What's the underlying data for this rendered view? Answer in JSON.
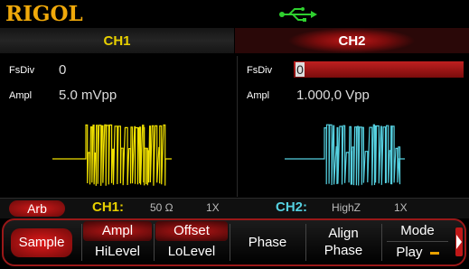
{
  "header": {
    "logo": "RIGOL",
    "usb_icon": "usb-icon"
  },
  "channels": [
    {
      "label": "CH1",
      "color": "#e8d000"
    },
    {
      "label": "CH2",
      "color": "#ffffff",
      "active": true
    }
  ],
  "ch1": {
    "fsdiv_label": "FsDiv",
    "fsdiv_value": "0",
    "ampl_label": "Ampl",
    "ampl_value": "5.0 mVpp",
    "wave_color": "#f0e000"
  },
  "ch2": {
    "fsdiv_label": "FsDiv",
    "fsdiv_value": "0",
    "ampl_label": "Ampl",
    "ampl_value": "1.000,0 Vpp",
    "wave_color": "#55d0e0"
  },
  "status": {
    "mode": "Arb",
    "ch1_label": "CH1:",
    "ch1_impedance": "50 Ω",
    "ch1_mult": "1X",
    "ch2_label": "CH2:",
    "ch2_impedance": "HighZ",
    "ch2_mult": "1X"
  },
  "softkeys": {
    "sample": "Sample",
    "ampl": "Ampl",
    "hilevel": "HiLevel",
    "offset": "Offset",
    "lolevel": "LoLevel",
    "phase": "Phase",
    "align_line1": "Align",
    "align_line2": "Phase",
    "mode": "Mode",
    "mode_value": "Play"
  }
}
